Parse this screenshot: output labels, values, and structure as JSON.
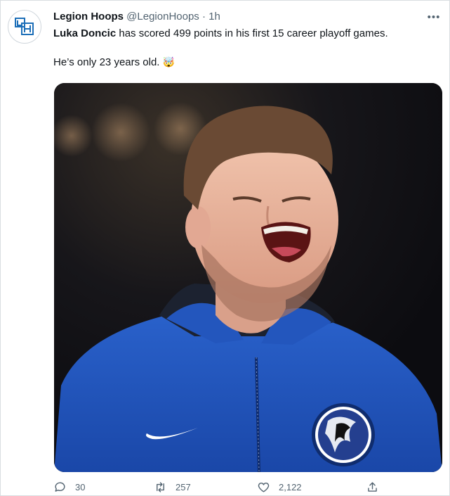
{
  "tweet": {
    "author_name": "Legion Hoops",
    "author_handle": "@LegionHoops",
    "separator": "·",
    "time": "1h",
    "text_bold": "Luka Doncic",
    "text_rest": " has scored 499 points in his first 15 career playoff games.",
    "text_line2": "He’s only 23 years old. ",
    "emoji": "🤯"
  },
  "actions": {
    "replies": "30",
    "retweets": "257",
    "likes": "2,122"
  },
  "icons": [
    "logo-icon",
    "more-icon",
    "reply-icon",
    "retweet-icon",
    "like-icon",
    "share-icon"
  ],
  "colors": {
    "text": "#0f1419",
    "secondary": "#536471",
    "jersey_blue": "#1f51b8"
  }
}
